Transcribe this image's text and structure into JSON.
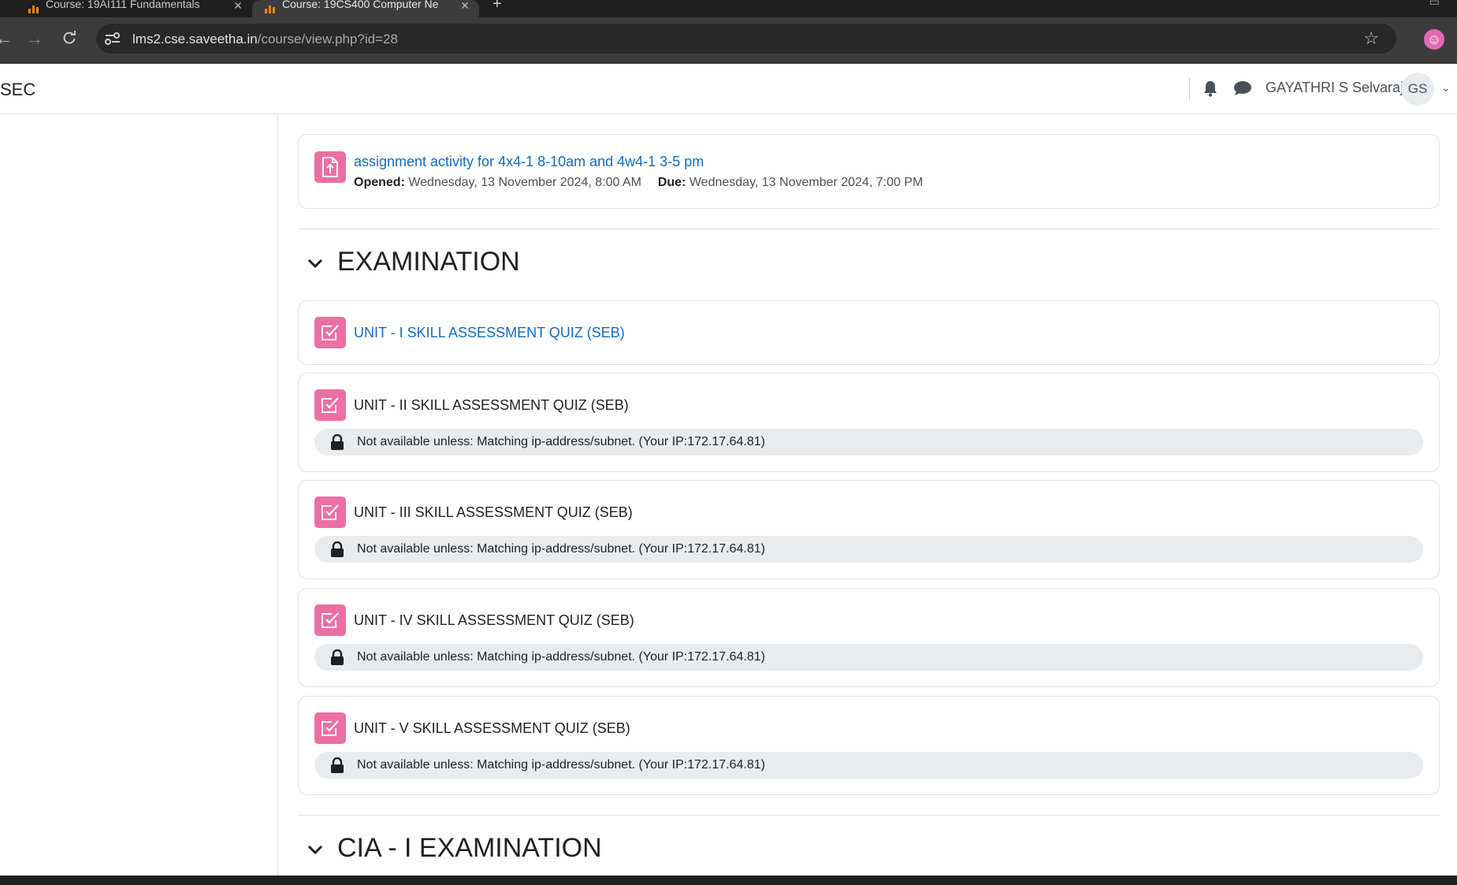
{
  "browser": {
    "tabs": [
      {
        "title": "Course: 19AI111 Fundamentals"
      },
      {
        "title": "Course: 19CS400 Computer Ne"
      }
    ],
    "url_host": "lms2.cse.saveetha.in",
    "url_path": "/course/view.php?id=28"
  },
  "header": {
    "brand": "SEC",
    "user_name": "GAYATHRI S Selvaraj",
    "avatar_initials": "GS"
  },
  "assignment": {
    "title": "assignment activity for 4x4-1 8-10am and 4w4-1 3-5 pm",
    "opened_label": "Opened:",
    "opened_value": "Wednesday, 13 November 2024, 8:00 AM",
    "due_label": "Due:",
    "due_value": "Wednesday, 13 November 2024, 7:00 PM"
  },
  "sections": [
    {
      "title": "EXAMINATION"
    },
    {
      "title": "CIA - I EXAMINATION"
    }
  ],
  "quizzes": [
    {
      "title": "UNIT - I SKILL ASSESSMENT QUIZ (SEB)",
      "restriction": ""
    },
    {
      "title": "UNIT - II SKILL ASSESSMENT QUIZ (SEB)",
      "restriction": "Not available unless: Matching ip-address/subnet. (Your IP:172.17.64.81)"
    },
    {
      "title": "UNIT - III SKILL ASSESSMENT QUIZ (SEB)",
      "restriction": "Not available unless: Matching ip-address/subnet. (Your IP:172.17.64.81)"
    },
    {
      "title": "UNIT - IV SKILL ASSESSMENT QUIZ (SEB)",
      "restriction": "Not available unless: Matching ip-address/subnet. (Your IP:172.17.64.81)"
    },
    {
      "title": "UNIT - V SKILL ASSESSMENT QUIZ (SEB)",
      "restriction": "Not available unless: Matching ip-address/subnet. (Your IP:172.17.64.81)"
    }
  ],
  "colors": {
    "activity_icon": "#ec6fa4",
    "link": "#0f6cbf",
    "restriction_bg": "#e9ecef"
  },
  "icons": {
    "assignment": "assignment-upload-icon",
    "quiz": "quiz-checkbox-icon",
    "restriction": "lock-icon",
    "section_toggle": "chevron-down-icon"
  }
}
